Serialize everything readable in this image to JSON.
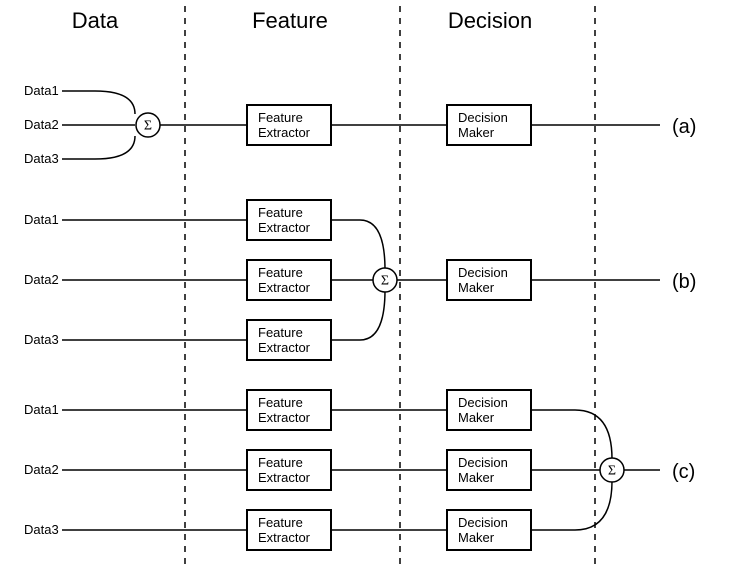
{
  "columns": {
    "data": "Data",
    "feature": "Feature",
    "decision": "Decision"
  },
  "rows": {
    "a": "(a)",
    "b": "(b)",
    "c": "(c)"
  },
  "labels": {
    "data1": "Data1",
    "data2": "Data2",
    "data3": "Data3",
    "feature_extractor_1": "Feature",
    "feature_extractor_2": "Extractor",
    "decision_maker_1": "Decision",
    "decision_maker_2": "Maker",
    "sigma": "Σ"
  }
}
